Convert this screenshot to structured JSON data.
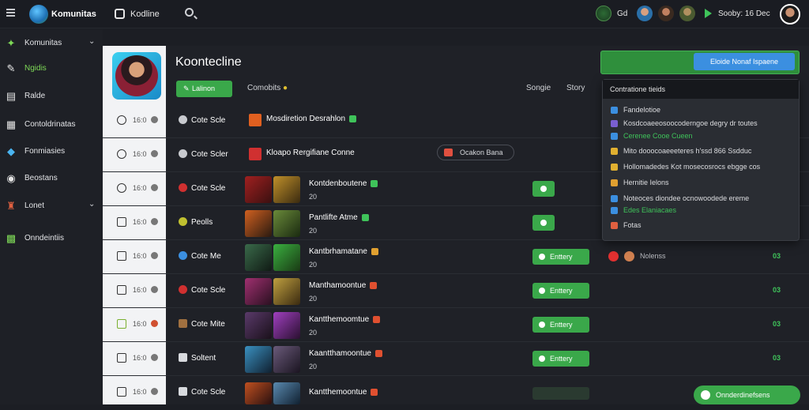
{
  "header": {
    "app_name": "Komunitas",
    "tab_label": "Kodline",
    "user_short": "Gd",
    "user_name": "Sooby: 16 Dec"
  },
  "sidebar": {
    "items": [
      {
        "label": "Komunitas",
        "icon": "spark-icon",
        "color": "#7ed957",
        "chevron": true
      },
      {
        "label": "Ngidis",
        "icon": "pin-icon",
        "color": "#e6e6e6"
      },
      {
        "label": "Ralde",
        "icon": "calendar-icon",
        "color": "#e6e6e6"
      },
      {
        "label": "Contoldrinatas",
        "icon": "chart-icon",
        "color": "#e6e6e6"
      },
      {
        "label": "Fonmiasies",
        "icon": "bird-icon",
        "color": "#4ab4f0"
      },
      {
        "label": "Beostans",
        "icon": "disc-icon",
        "color": "#e6e6e6"
      },
      {
        "label": "Lonet",
        "icon": "character-icon",
        "color": "#e06040",
        "chevron": true
      },
      {
        "label": "Onndeintiis",
        "icon": "map-icon",
        "color": "#7ed957"
      }
    ]
  },
  "main": {
    "title": "Koontecline",
    "edit_button": "Lalinon",
    "tabs": [
      "Comobits",
      "Songie",
      "Story"
    ],
    "banner_button": "Eloide Nonaf Ispaene",
    "filter_chip": "Ocakon Bana"
  },
  "rows": [
    {
      "num": "16:0",
      "label": "Cote Scle",
      "name": "Mosdiretion Desrahlon",
      "sub": "",
      "button": ""
    },
    {
      "num": "16:0",
      "label": "Cote Scler",
      "name": "Kloapo Rergifiane Conne",
      "sub": "",
      "button": ""
    },
    {
      "num": "16:0",
      "label": "Cote Scle",
      "name": "Kontdenboutene",
      "sub": "20",
      "button": ""
    },
    {
      "num": "16:0",
      "label": "Peolls",
      "name": "Pantlifte Atme",
      "sub": "20",
      "button": ""
    },
    {
      "num": "16:0",
      "label": "Cote Me",
      "name": "Kantbrhamatane",
      "sub": "20",
      "button": "Enttery",
      "extra": "Nolenss",
      "tag": "03"
    },
    {
      "num": "16:0",
      "label": "Cote Scle",
      "name": "Manthamoontue",
      "sub": "20",
      "button": "Enttery",
      "tag": "03"
    },
    {
      "num": "16:0",
      "label": "Cote Mite",
      "name": "Kantthemoomtue",
      "sub": "20",
      "button": "Enttery",
      "tag": "03"
    },
    {
      "num": "16:0",
      "label": "Soltent",
      "name": "Kaantthamoontue",
      "sub": "20",
      "button": "Enttery",
      "tag": "03"
    },
    {
      "num": "16:0",
      "label": "Cote Scle",
      "name": "Kantthemoontue",
      "sub": "",
      "button": "",
      "tag": ""
    }
  ],
  "dropdown": {
    "header": "Contratione tieids",
    "items": [
      {
        "text": "Fandelotioe",
        "color": "#3b8fe0"
      },
      {
        "text": "Kosdcoaeeosoocoderngoe degry dr toutes",
        "color": "#7a5fd0"
      },
      {
        "text": "Cerenee Cooe Cueen",
        "color": "#3b8fe0"
      },
      {
        "text": "Mito dooocoaeeeteres h'ssd 866 Ssdduc",
        "color": "#e0b030"
      },
      {
        "text": "Hollomadedes Kot mosecosrocs ebgge cos",
        "color": "#e0b030"
      },
      {
        "text": "Hernitie Ielons",
        "color": "#e0a030"
      },
      {
        "text": "Noteoces diondee ocnowoodede ereme",
        "color": "#3b8fe0"
      },
      {
        "text": "Edes Elaniacaes",
        "color": "#3b8fe0"
      },
      {
        "text": "Fotas",
        "color": "#e06040"
      }
    ]
  },
  "float_button": "Onnderdinefsens"
}
